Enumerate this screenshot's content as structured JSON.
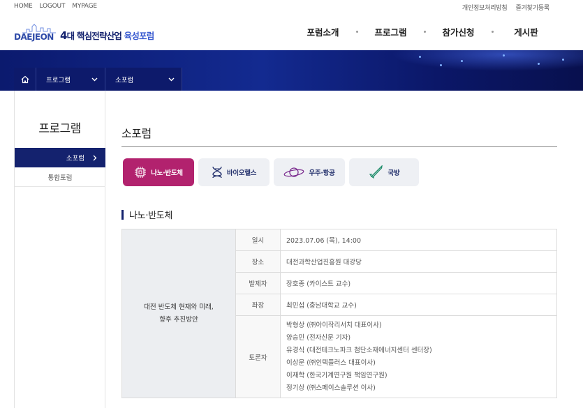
{
  "util": {
    "left": [
      "HOME",
      "LOGOUT",
      "MYPAGE"
    ],
    "right": [
      "개인정보처리방침",
      "즐겨찾기등록"
    ]
  },
  "logo": {
    "word": "DAEJEON",
    "num": "4",
    "title_a": "대 핵심전략산업 ",
    "title_b": "육성포럼"
  },
  "gnb": [
    "포럼소개",
    "프로그램",
    "참가신청",
    "게시판"
  ],
  "breadcrumb": {
    "level1": "프로그램",
    "level2": "소포럼"
  },
  "sidebar": {
    "title": "프로그램",
    "items": [
      {
        "label": "소포럼",
        "active": true
      },
      {
        "label": "통합포럼",
        "active": false
      }
    ]
  },
  "page": {
    "title": "소포럼",
    "section": "나노·반도체"
  },
  "tabs": [
    {
      "label": "나노·반도체",
      "icon": "chip-icon",
      "active": true
    },
    {
      "label": "바이오헬스",
      "icon": "dna-icon",
      "active": false
    },
    {
      "label": "우주·항공",
      "icon": "planet-icon",
      "active": false
    },
    {
      "label": "국방",
      "icon": "missile-icon",
      "active": false
    }
  ],
  "session": {
    "subject_line1": "대전 반도체 현재와 미래,",
    "subject_line2": "향후 추진방안",
    "rows": [
      {
        "key": "일시",
        "value": "2023.07.06 (목), 14:00"
      },
      {
        "key": "장소",
        "value": "대전과학산업진흥원 대강당"
      },
      {
        "key": "발제자",
        "value": "장호종 (카이스트 교수)"
      },
      {
        "key": "좌장",
        "value": "최민섭 (충남대학교 교수)"
      }
    ],
    "panel_key": "토론자",
    "panel": [
      "박형상 (㈜아이작리서치 대표이사)",
      "양승민 (전자신문 기자)",
      "유경식 (대전테크노파크 첨단소재에너지센터 센터장)",
      "이상문 (㈜인텍플러스 대표이사)",
      "이재학 (한국기계연구원 책임연구원)",
      "정기상 (㈜스페이스솔루션 이사)"
    ]
  },
  "colors": {
    "navy": "#14226e",
    "accent": "#b2226e",
    "banner": "#132a90"
  }
}
